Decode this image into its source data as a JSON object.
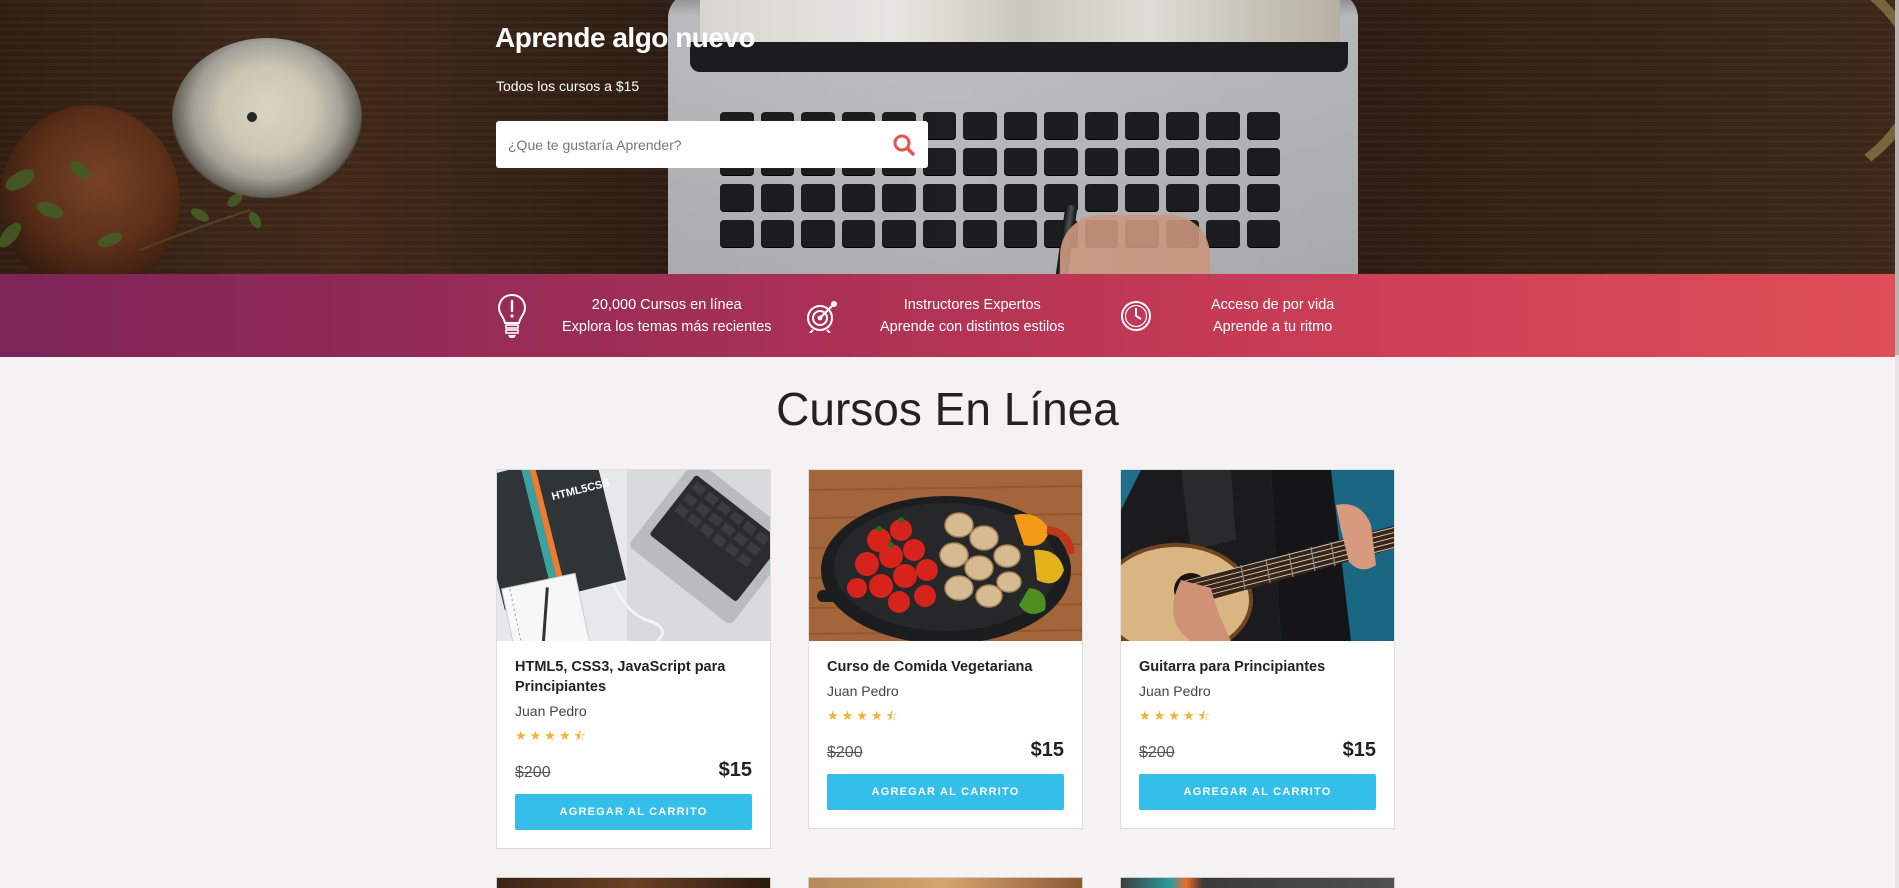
{
  "hero": {
    "title": "Aprende algo nuevo",
    "subtitle": "Todos los cursos a $15",
    "search": {
      "placeholder": "¿Que te gustaría Aprender?",
      "value": "",
      "icon": "search-icon"
    }
  },
  "features": [
    {
      "icon": "lightbulb-icon",
      "line1": "20,000 Cursos en línea",
      "line2": "Explora los temas más recientes"
    },
    {
      "icon": "target-icon",
      "line1": "Instructores Expertos",
      "line2": "Aprende con distintos estilos"
    },
    {
      "icon": "clock-icon",
      "line1": "Acceso de por vida",
      "line2": "Aprende a tu ritmo"
    }
  ],
  "section": {
    "title": "Cursos En Línea"
  },
  "courses": [
    {
      "title": "HTML5, CSS3, JavaScript para Principiantes",
      "author": "Juan Pedro",
      "stars": "★★★★⯪",
      "rating": 4.5,
      "old_price": "$200",
      "price": "$15",
      "button": "AGREGAR AL CARRITO",
      "image_text": "HTML5CSS"
    },
    {
      "title": "Curso de Comida Vegetariana",
      "author": "Juan Pedro",
      "stars": "★★★★⯪",
      "rating": 4.5,
      "old_price": "$200",
      "price": "$15",
      "button": "AGREGAR AL CARRITO"
    },
    {
      "title": "Guitarra para Principiantes",
      "author": "Juan Pedro",
      "stars": "★★★★⯪",
      "rating": 4.5,
      "old_price": "$200",
      "price": "$15",
      "button": "AGREGAR AL CARRITO"
    }
  ],
  "colors": {
    "accent": "#33bfe9",
    "search_icon": "#e8534d",
    "stars": "#f2b233",
    "band_start": "#7d2458",
    "band_end": "#e04f57"
  }
}
